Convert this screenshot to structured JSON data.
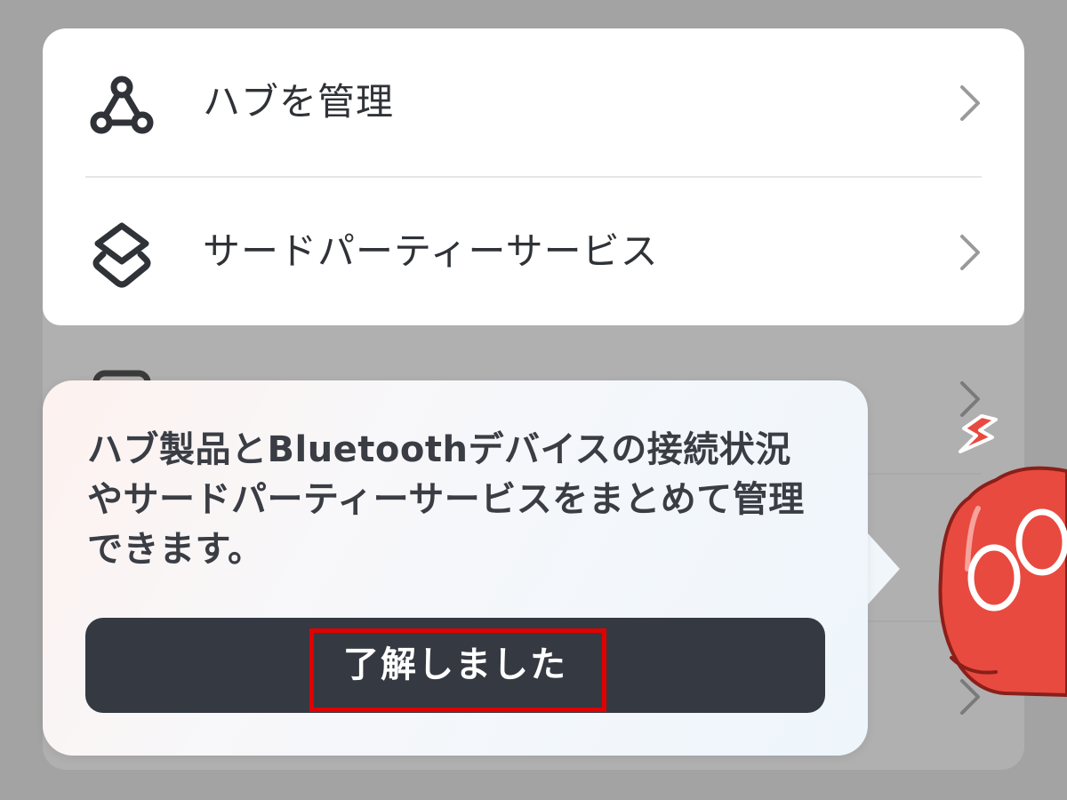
{
  "settings_list": {
    "items": [
      {
        "label": "ハブを管理",
        "icon": "hub-icon"
      },
      {
        "label": "サードパーティーサービス",
        "icon": "layers-icon"
      }
    ]
  },
  "tooltip": {
    "message": "ハブ製品とBluetoothデバイスの接続状況やサードパーティーサービスをまとめて管理できます。",
    "button_label": "了解しました"
  },
  "colors": {
    "overlay": "#a3a3a3",
    "card": "#ffffff",
    "button": "#353942",
    "annotation": "#e00000",
    "mascot": "#e84a3f"
  }
}
